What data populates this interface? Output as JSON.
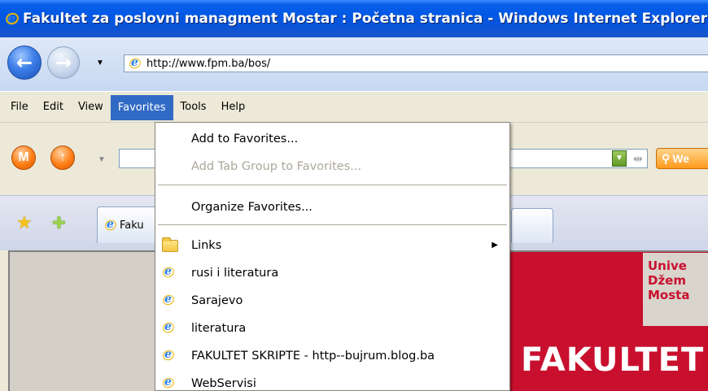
{
  "window": {
    "title": "Fakultet za poslovni managment Mostar : Početna stranica - Windows Internet Explorer"
  },
  "address_bar": {
    "url": "http://www.fpm.ba/bos/"
  },
  "menubar": {
    "items": [
      "File",
      "Edit",
      "View",
      "Favorites",
      "Tools",
      "Help"
    ],
    "active": "Favorites"
  },
  "search_toolbar": {
    "orb1_letter": "M",
    "web_button_label": "We"
  },
  "tabs": [
    {
      "label": "Faku"
    }
  ],
  "favorites_menu": {
    "add": "Add to Favorites...",
    "add_tab_group": "Add Tab Group to Favorites...",
    "organize": "Organize Favorites...",
    "items": [
      {
        "label": "Links",
        "icon": "folder-icon",
        "submenu": true
      },
      {
        "label": "rusi i literatura",
        "icon": "ie-page-icon"
      },
      {
        "label": "Sarajevo",
        "icon": "ie-page-icon"
      },
      {
        "label": "literatura",
        "icon": "ie-page-icon"
      },
      {
        "label": "FAKULTET SKRIPTE - http--bujrum.blog.ba",
        "icon": "ie-page-icon"
      },
      {
        "label": "WebServisi",
        "icon": "ie-page-icon"
      }
    ]
  },
  "page_content": {
    "uni_lines": [
      "Unive",
      "Džem",
      "Mosta"
    ],
    "banner_text": "FAKULTET"
  },
  "colors": {
    "title_bar": "#0058e6",
    "menu_highlight": "#316ac5",
    "banner_red": "#c8102e"
  }
}
